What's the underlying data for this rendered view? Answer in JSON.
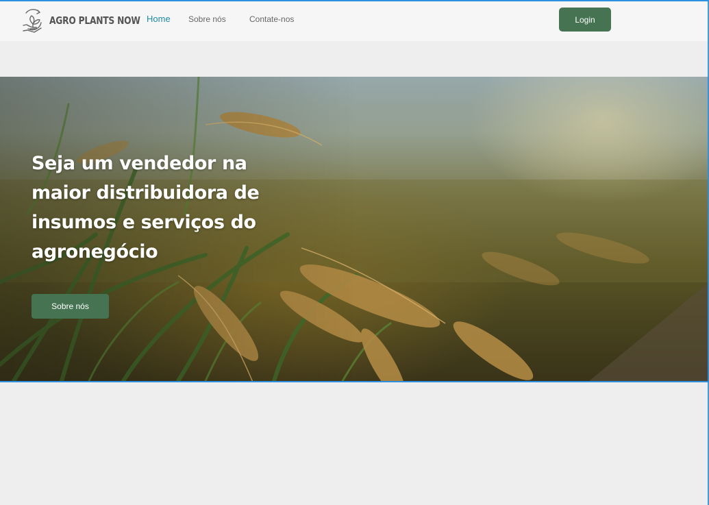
{
  "brand": {
    "name": "AGRO PLANTS NOW",
    "icon": "plant-in-hand-icon"
  },
  "nav": {
    "items": [
      {
        "label": "Home",
        "active": true
      },
      {
        "label": "Sobre nós",
        "active": false
      },
      {
        "label": "Contate-nos",
        "active": false
      }
    ]
  },
  "header": {
    "login_label": "Login"
  },
  "hero": {
    "title": "Seja um vendedor na maior distribuidora de insumos e serviços do agronegócio",
    "button_label": "Sobre nós"
  },
  "colors": {
    "accent_green": "#467452",
    "nav_active": "#1d8aa8",
    "page_bg": "#efeeee",
    "selection_blue": "#2d8fe0"
  }
}
